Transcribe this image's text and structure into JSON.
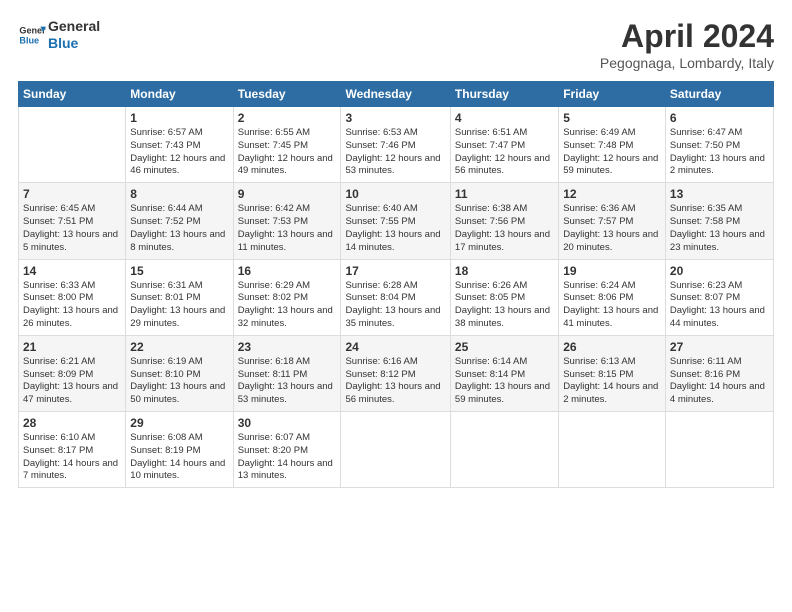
{
  "header": {
    "logo_line1": "General",
    "logo_line2": "Blue",
    "month": "April 2024",
    "location": "Pegognaga, Lombardy, Italy"
  },
  "days_of_week": [
    "Sunday",
    "Monday",
    "Tuesday",
    "Wednesday",
    "Thursday",
    "Friday",
    "Saturday"
  ],
  "weeks": [
    [
      {
        "day": "",
        "info": ""
      },
      {
        "day": "1",
        "info": "Sunrise: 6:57 AM\nSunset: 7:43 PM\nDaylight: 12 hours\nand 46 minutes."
      },
      {
        "day": "2",
        "info": "Sunrise: 6:55 AM\nSunset: 7:45 PM\nDaylight: 12 hours\nand 49 minutes."
      },
      {
        "day": "3",
        "info": "Sunrise: 6:53 AM\nSunset: 7:46 PM\nDaylight: 12 hours\nand 53 minutes."
      },
      {
        "day": "4",
        "info": "Sunrise: 6:51 AM\nSunset: 7:47 PM\nDaylight: 12 hours\nand 56 minutes."
      },
      {
        "day": "5",
        "info": "Sunrise: 6:49 AM\nSunset: 7:48 PM\nDaylight: 12 hours\nand 59 minutes."
      },
      {
        "day": "6",
        "info": "Sunrise: 6:47 AM\nSunset: 7:50 PM\nDaylight: 13 hours\nand 2 minutes."
      }
    ],
    [
      {
        "day": "7",
        "info": "Sunrise: 6:45 AM\nSunset: 7:51 PM\nDaylight: 13 hours\nand 5 minutes."
      },
      {
        "day": "8",
        "info": "Sunrise: 6:44 AM\nSunset: 7:52 PM\nDaylight: 13 hours\nand 8 minutes."
      },
      {
        "day": "9",
        "info": "Sunrise: 6:42 AM\nSunset: 7:53 PM\nDaylight: 13 hours\nand 11 minutes."
      },
      {
        "day": "10",
        "info": "Sunrise: 6:40 AM\nSunset: 7:55 PM\nDaylight: 13 hours\nand 14 minutes."
      },
      {
        "day": "11",
        "info": "Sunrise: 6:38 AM\nSunset: 7:56 PM\nDaylight: 13 hours\nand 17 minutes."
      },
      {
        "day": "12",
        "info": "Sunrise: 6:36 AM\nSunset: 7:57 PM\nDaylight: 13 hours\nand 20 minutes."
      },
      {
        "day": "13",
        "info": "Sunrise: 6:35 AM\nSunset: 7:58 PM\nDaylight: 13 hours\nand 23 minutes."
      }
    ],
    [
      {
        "day": "14",
        "info": "Sunrise: 6:33 AM\nSunset: 8:00 PM\nDaylight: 13 hours\nand 26 minutes."
      },
      {
        "day": "15",
        "info": "Sunrise: 6:31 AM\nSunset: 8:01 PM\nDaylight: 13 hours\nand 29 minutes."
      },
      {
        "day": "16",
        "info": "Sunrise: 6:29 AM\nSunset: 8:02 PM\nDaylight: 13 hours\nand 32 minutes."
      },
      {
        "day": "17",
        "info": "Sunrise: 6:28 AM\nSunset: 8:04 PM\nDaylight: 13 hours\nand 35 minutes."
      },
      {
        "day": "18",
        "info": "Sunrise: 6:26 AM\nSunset: 8:05 PM\nDaylight: 13 hours\nand 38 minutes."
      },
      {
        "day": "19",
        "info": "Sunrise: 6:24 AM\nSunset: 8:06 PM\nDaylight: 13 hours\nand 41 minutes."
      },
      {
        "day": "20",
        "info": "Sunrise: 6:23 AM\nSunset: 8:07 PM\nDaylight: 13 hours\nand 44 minutes."
      }
    ],
    [
      {
        "day": "21",
        "info": "Sunrise: 6:21 AM\nSunset: 8:09 PM\nDaylight: 13 hours\nand 47 minutes."
      },
      {
        "day": "22",
        "info": "Sunrise: 6:19 AM\nSunset: 8:10 PM\nDaylight: 13 hours\nand 50 minutes."
      },
      {
        "day": "23",
        "info": "Sunrise: 6:18 AM\nSunset: 8:11 PM\nDaylight: 13 hours\nand 53 minutes."
      },
      {
        "day": "24",
        "info": "Sunrise: 6:16 AM\nSunset: 8:12 PM\nDaylight: 13 hours\nand 56 minutes."
      },
      {
        "day": "25",
        "info": "Sunrise: 6:14 AM\nSunset: 8:14 PM\nDaylight: 13 hours\nand 59 minutes."
      },
      {
        "day": "26",
        "info": "Sunrise: 6:13 AM\nSunset: 8:15 PM\nDaylight: 14 hours\nand 2 minutes."
      },
      {
        "day": "27",
        "info": "Sunrise: 6:11 AM\nSunset: 8:16 PM\nDaylight: 14 hours\nand 4 minutes."
      }
    ],
    [
      {
        "day": "28",
        "info": "Sunrise: 6:10 AM\nSunset: 8:17 PM\nDaylight: 14 hours\nand 7 minutes."
      },
      {
        "day": "29",
        "info": "Sunrise: 6:08 AM\nSunset: 8:19 PM\nDaylight: 14 hours\nand 10 minutes."
      },
      {
        "day": "30",
        "info": "Sunrise: 6:07 AM\nSunset: 8:20 PM\nDaylight: 14 hours\nand 13 minutes."
      },
      {
        "day": "",
        "info": ""
      },
      {
        "day": "",
        "info": ""
      },
      {
        "day": "",
        "info": ""
      },
      {
        "day": "",
        "info": ""
      }
    ]
  ]
}
